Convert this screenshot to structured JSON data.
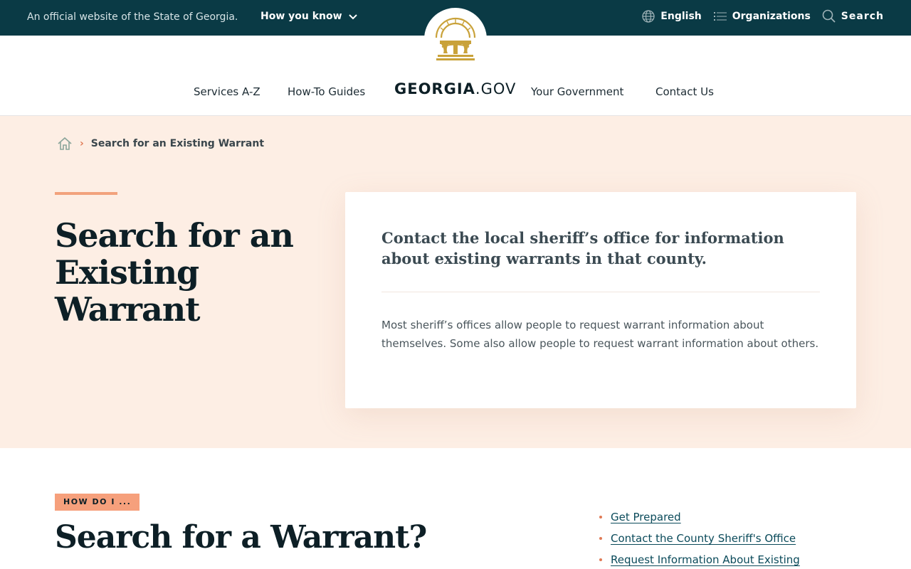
{
  "topbar": {
    "official_text": "An official website of the State of Georgia.",
    "how_you_know": "How you know",
    "language": "English",
    "organizations": "Organizations",
    "search": "Search"
  },
  "header": {
    "brand_bold": "GEORGIA",
    "brand_light": ".GOV",
    "nav": [
      "Services A-Z",
      "How-To Guides",
      "Your Government",
      "Contact Us"
    ]
  },
  "breadcrumb": {
    "current": "Search for an Existing Warrant"
  },
  "hero": {
    "title": "Search for an Existing Warrant",
    "lead": "Contact the local sheriff’s office for information about existing warrants in that county.",
    "body": "Most sheriff’s offices allow people to request warrant information about themselves. Some also allow people to request warrant information about others."
  },
  "section": {
    "tag": "HOW DO I ...",
    "heading": "Search for a Warrant?",
    "toc": [
      "Get Prepared",
      "Contact the County Sheriff's Office",
      "Request Information About Existing"
    ]
  },
  "colors": {
    "topbar": "#0a3a45",
    "hero_bg": "#fdeee4",
    "accent": "#f2a27c",
    "seal_gold": "#c9a23a"
  }
}
